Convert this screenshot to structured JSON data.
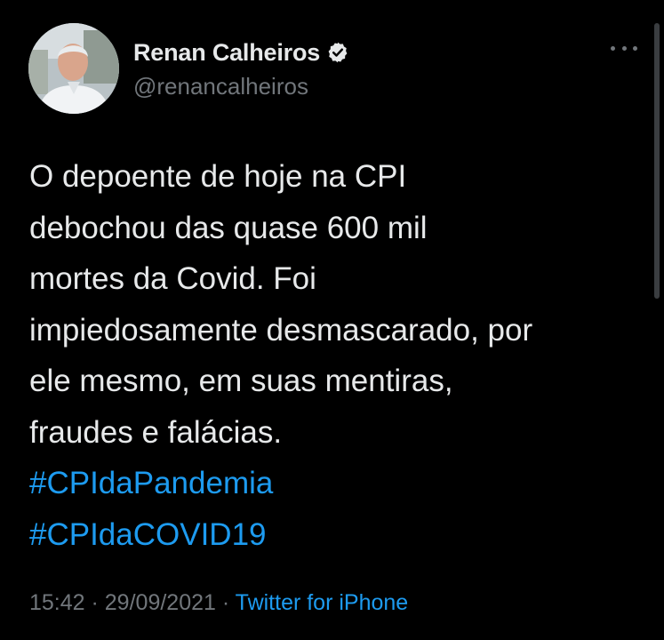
{
  "author": {
    "display_name": "Renan Calheiros",
    "handle": "@renancalheiros",
    "verified": true
  },
  "tweet": {
    "lines": [
      "O depoente de hoje na CPI",
      "debochou das quase 600 mil",
      "mortes da Covid. Foi",
      "impiedosamente desmascarado, por",
      "ele mesmo, em suas mentiras,",
      "fraudes e falácias."
    ],
    "hashtags": [
      "#CPIdaPandemia",
      "#CPIdaCOVID19"
    ]
  },
  "meta": {
    "time": "15:42",
    "separator": " · ",
    "date": "29/09/2021",
    "source": "Twitter for iPhone"
  },
  "colors": {
    "background": "#000000",
    "text": "#e7e9ea",
    "secondary": "#71767b",
    "link": "#1d9bf0"
  },
  "icons": {
    "verified": "verified-badge-icon",
    "more": "more-options-icon"
  }
}
